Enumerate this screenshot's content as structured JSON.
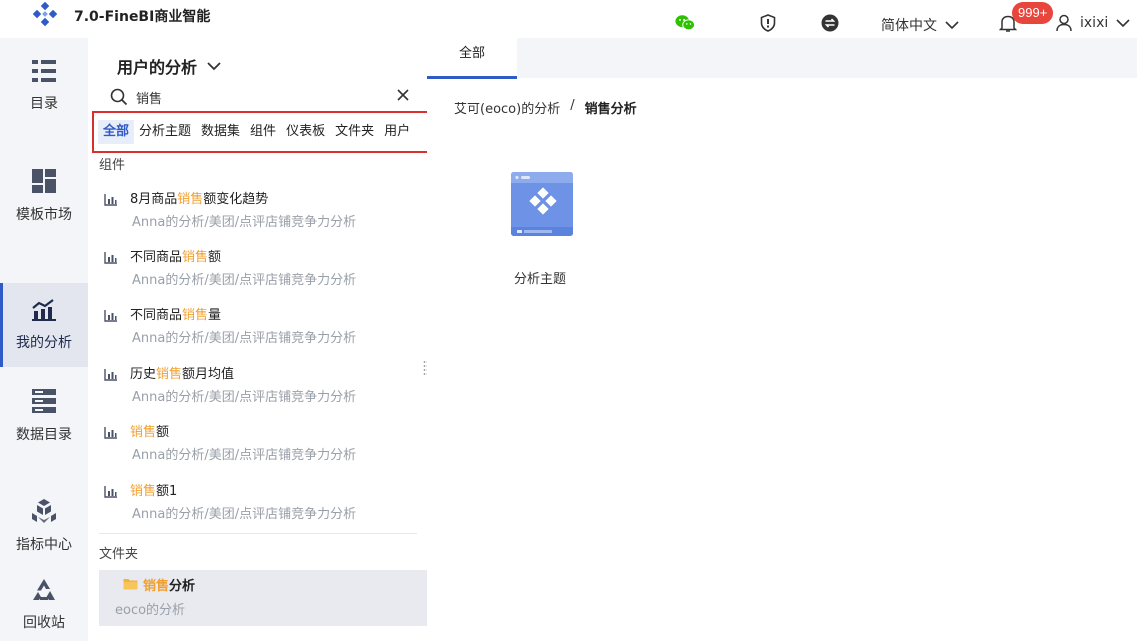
{
  "app": {
    "title": "7.0-FineBI商业智能"
  },
  "header": {
    "language": "简体中文",
    "notification_badge": "999+",
    "username": "ixixi"
  },
  "leftnav": {
    "items": [
      {
        "label": "目录",
        "icon": "catalog-icon"
      },
      {
        "label": "模板市场",
        "icon": "template-market-icon"
      },
      {
        "label": "我的分析",
        "icon": "my-analysis-icon",
        "active": true
      },
      {
        "label": "数据目录",
        "icon": "data-catalog-icon"
      },
      {
        "label": "指标中心",
        "icon": "metrics-center-icon"
      },
      {
        "label": "回收站",
        "icon": "recycle-bin-icon"
      }
    ]
  },
  "panel": {
    "title": "用户的分析",
    "search_value": "销售",
    "filter_tabs": [
      "全部",
      "分析主题",
      "数据集",
      "组件",
      "仪表板",
      "文件夹",
      "用户"
    ],
    "active_filter": "全部",
    "components_label": "组件",
    "components": [
      {
        "prefix": "8月商品",
        "highlight": "销售",
        "suffix": "额变化趋势",
        "path": "Anna的分析/美团/点评店铺竞争力分析"
      },
      {
        "prefix": "不同商品",
        "highlight": "销售",
        "suffix": "额",
        "path": "Anna的分析/美团/点评店铺竞争力分析"
      },
      {
        "prefix": "不同商品",
        "highlight": "销售",
        "suffix": "量",
        "path": "Anna的分析/美团/点评店铺竞争力分析"
      },
      {
        "prefix": "历史",
        "highlight": "销售",
        "suffix": "额月均值",
        "path": "Anna的分析/美团/点评店铺竞争力分析"
      },
      {
        "prefix": "",
        "highlight": "销售",
        "suffix": "额",
        "path": "Anna的分析/美团/点评店铺竞争力分析"
      },
      {
        "prefix": "",
        "highlight": "销售",
        "suffix": "额1",
        "path": "Anna的分析/美团/点评店铺竞争力分析"
      }
    ],
    "folders_label": "文件夹",
    "folder": {
      "highlight": "销售",
      "suffix": "分析",
      "path": "eoco的分析"
    }
  },
  "main": {
    "tab_label": "全部",
    "breadcrumb": {
      "parent": "艾可(eoco)的分析",
      "separator": "/",
      "current": "销售分析"
    },
    "tiles": [
      {
        "label": "分析主题",
        "icon": "analysis-subject-icon"
      }
    ]
  },
  "colors": {
    "accent": "#2f5bc9",
    "highlight": "#f0a030",
    "annotation_border": "#d9302f",
    "badge": "#e8453c",
    "wechat": "#2dc100"
  }
}
